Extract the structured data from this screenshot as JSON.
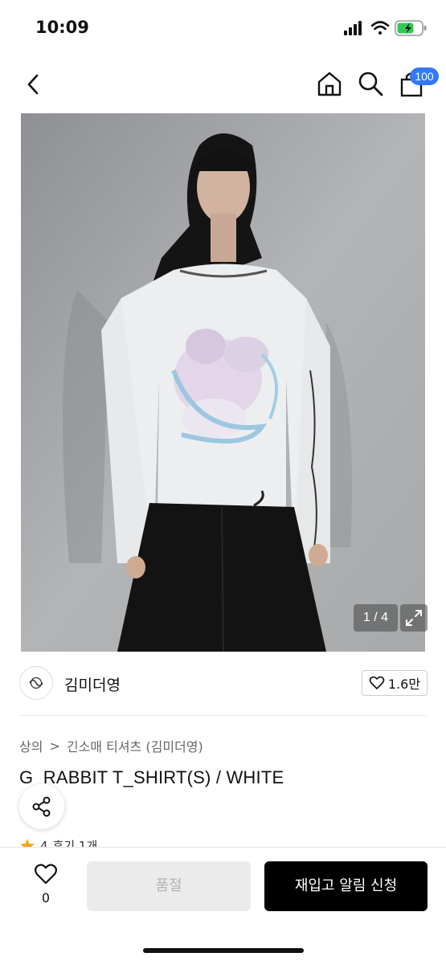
{
  "status": {
    "time": "10:09"
  },
  "cart": {
    "badge": "100"
  },
  "image": {
    "counter": "1 / 4"
  },
  "brand": {
    "name": "김미더영",
    "likes": "1.6만"
  },
  "breadcrumb": {
    "category": "상의",
    "separator": ">",
    "subcategory": "긴소매 티셔츠 (김미더영)"
  },
  "product": {
    "title": "G_RABBIT T_SHIRT(S) / WHITE"
  },
  "rating": {
    "score": "4",
    "reviews": "후기 1개"
  },
  "bottom": {
    "wish_count": "0",
    "soldout_label": "품절",
    "restock_label": "재입고 알림 신청"
  },
  "colors": {
    "accent": "#3478f6",
    "primary_button": "#000000",
    "disabled_button": "#ebebeb",
    "star": "#f5a623"
  }
}
